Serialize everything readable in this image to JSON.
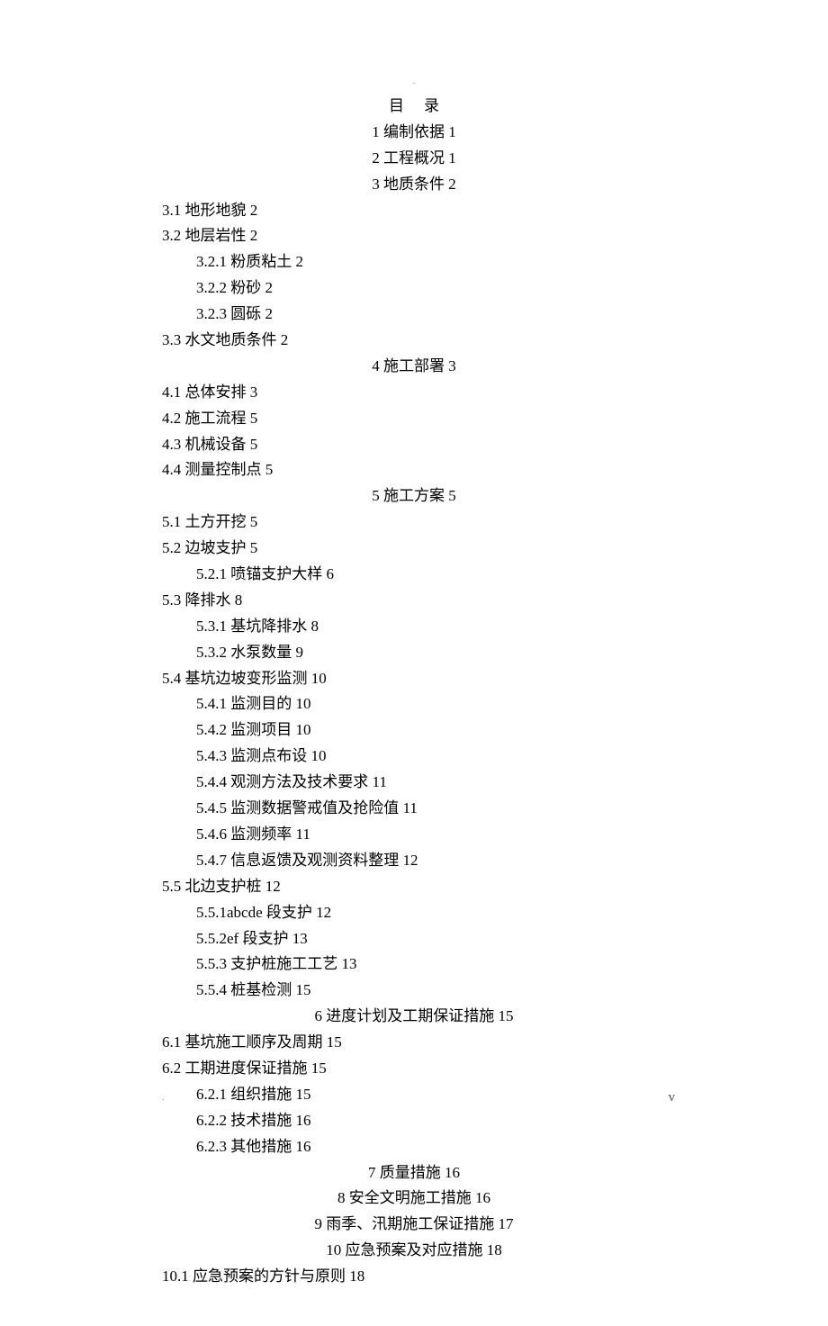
{
  "header_dot": ".",
  "title": "目录",
  "entries": [
    {
      "type": "centered",
      "text": "1 编制依据 1"
    },
    {
      "type": "centered",
      "text": "2 工程概况 1"
    },
    {
      "type": "centered",
      "text": "3 地质条件 2"
    },
    {
      "type": "l1",
      "text": "3.1 地形地貌 2"
    },
    {
      "type": "l1",
      "text": "3.2 地层岩性 2"
    },
    {
      "type": "l2",
      "text": "3.2.1 粉质粘土 2"
    },
    {
      "type": "l2",
      "text": "3.2.2 粉砂 2"
    },
    {
      "type": "l2",
      "text": "3.2.3 圆砾 2"
    },
    {
      "type": "l1",
      "text": "3.3 水文地质条件 2"
    },
    {
      "type": "centered",
      "text": "4 施工部署 3"
    },
    {
      "type": "l1",
      "text": "4.1 总体安排 3"
    },
    {
      "type": "l1",
      "text": "4.2 施工流程 5"
    },
    {
      "type": "l1",
      "text": "4.3 机械设备 5"
    },
    {
      "type": "l1",
      "text": "4.4 测量控制点 5"
    },
    {
      "type": "centered",
      "text": "5 施工方案 5"
    },
    {
      "type": "l1",
      "text": "5.1 土方开挖 5"
    },
    {
      "type": "l1",
      "text": "5.2 边坡支护 5"
    },
    {
      "type": "l2",
      "text": "5.2.1 喷锚支护大样 6"
    },
    {
      "type": "l1",
      "text": "5.3 降排水 8"
    },
    {
      "type": "l2",
      "text": "5.3.1 基坑降排水 8"
    },
    {
      "type": "l2",
      "text": "5.3.2 水泵数量 9"
    },
    {
      "type": "l1",
      "text": "5.4 基坑边坡变形监测 10"
    },
    {
      "type": "l2",
      "text": "5.4.1 监测目的 10"
    },
    {
      "type": "l2",
      "text": "5.4.2 监测项目 10"
    },
    {
      "type": "l2",
      "text": "5.4.3 监测点布设 10"
    },
    {
      "type": "l2",
      "text": "5.4.4 观测方法及技术要求 11"
    },
    {
      "type": "l2",
      "text": "5.4.5 监测数据警戒值及抢险值 11"
    },
    {
      "type": "l2",
      "text": "5.4.6 监测频率 11"
    },
    {
      "type": "l2",
      "text": "5.4.7 信息返馈及观测资料整理 12"
    },
    {
      "type": "l1",
      "text": "5.5 北边支护桩 12"
    },
    {
      "type": "l2",
      "text": "5.5.1abcde 段支护 12"
    },
    {
      "type": "l2",
      "text": "5.5.2ef 段支护 13"
    },
    {
      "type": "l2",
      "text": "5.5.3 支护桩施工工艺 13"
    },
    {
      "type": "l2",
      "text": "5.5.4 桩基检测 15"
    },
    {
      "type": "centered",
      "text": "6 进度计划及工期保证措施 15"
    },
    {
      "type": "l1",
      "text": "6.1 基坑施工顺序及周期 15"
    },
    {
      "type": "l1",
      "text": "6.2 工期进度保证措施 15"
    },
    {
      "type": "l2",
      "text": "6.2.1 组织措施 15"
    },
    {
      "type": "l2",
      "text": "6.2.2 技术措施 16"
    },
    {
      "type": "l2",
      "text": "6.2.3 其他措施 16"
    },
    {
      "type": "centered",
      "text": "7 质量措施 16"
    },
    {
      "type": "centered",
      "text": "8 安全文明施工措施 16"
    },
    {
      "type": "centered",
      "text": "9 雨季、汛期施工保证措施 17"
    },
    {
      "type": "centered",
      "text": "10 应急预案及对应措施 18"
    },
    {
      "type": "l1",
      "text": "10.1 应急预案的方针与原则 18"
    }
  ],
  "footer_dot": ".",
  "footer_marker": "v"
}
